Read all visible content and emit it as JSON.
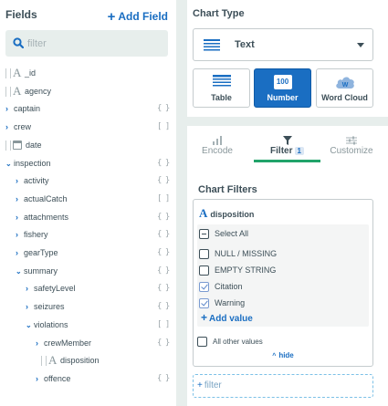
{
  "fields_panel": {
    "title": "Fields",
    "add_field_label": "Add Field",
    "filter_placeholder": "filter",
    "items": [
      {
        "label": "_id",
        "kind": "string",
        "expandable": false,
        "badge": "",
        "depth": 0
      },
      {
        "label": "agency",
        "kind": "string",
        "expandable": false,
        "badge": "",
        "depth": 0
      },
      {
        "label": "captain",
        "kind": "object",
        "expandable": true,
        "expanded": false,
        "badge": "{ }",
        "depth": 0
      },
      {
        "label": "crew",
        "kind": "array",
        "expandable": true,
        "expanded": false,
        "badge": "[ ]",
        "depth": 0
      },
      {
        "label": "date",
        "kind": "date",
        "expandable": false,
        "badge": "",
        "depth": 0
      },
      {
        "label": "inspection",
        "kind": "object",
        "expandable": true,
        "expanded": true,
        "badge": "{ }",
        "depth": 0
      },
      {
        "label": "activity",
        "kind": "object",
        "expandable": true,
        "expanded": false,
        "badge": "{ }",
        "depth": 1
      },
      {
        "label": "actualCatch",
        "kind": "array",
        "expandable": true,
        "expanded": false,
        "badge": "[ ]",
        "depth": 1
      },
      {
        "label": "attachments",
        "kind": "object",
        "expandable": true,
        "expanded": false,
        "badge": "{ }",
        "depth": 1
      },
      {
        "label": "fishery",
        "kind": "object",
        "expandable": true,
        "expanded": false,
        "badge": "{ }",
        "depth": 1
      },
      {
        "label": "gearType",
        "kind": "object",
        "expandable": true,
        "expanded": false,
        "badge": "{ }",
        "depth": 1
      },
      {
        "label": "summary",
        "kind": "object",
        "expandable": true,
        "expanded": true,
        "badge": "{ }",
        "depth": 1
      },
      {
        "label": "safetyLevel",
        "kind": "object",
        "expandable": true,
        "expanded": false,
        "badge": "{ }",
        "depth": 2
      },
      {
        "label": "seizures",
        "kind": "object",
        "expandable": true,
        "expanded": false,
        "badge": "{ }",
        "depth": 2
      },
      {
        "label": "violations",
        "kind": "array",
        "expandable": true,
        "expanded": true,
        "badge": "[ ]",
        "depth": 2
      },
      {
        "label": "crewMember",
        "kind": "object",
        "expandable": true,
        "expanded": false,
        "badge": "{ }",
        "depth": 3
      },
      {
        "label": "disposition",
        "kind": "string",
        "expandable": false,
        "badge": "",
        "depth": 3
      },
      {
        "label": "offence",
        "kind": "object",
        "expandable": true,
        "expanded": false,
        "badge": "{ }",
        "depth": 3
      }
    ]
  },
  "chart_type": {
    "title": "Chart Type",
    "selected": "Text",
    "tiles": [
      {
        "label": "Table",
        "icon": "table-icon",
        "active": false
      },
      {
        "label": "Number",
        "icon": "number-icon",
        "icon_text": "100",
        "active": true
      },
      {
        "label": "Word Cloud",
        "icon": "word-cloud-icon",
        "icon_text": "W",
        "active": false
      }
    ]
  },
  "tabs": [
    {
      "label": "Encode",
      "icon": "encode-icon",
      "active": false
    },
    {
      "label": "Filter",
      "icon": "filter-icon",
      "active": true,
      "count": "1"
    },
    {
      "label": "Customize",
      "icon": "customize-icon",
      "active": false
    }
  ],
  "chart_filters": {
    "title": "Chart Filters",
    "field": "disposition",
    "options": [
      {
        "label": "Select All",
        "state": "partial"
      },
      {
        "label": "NULL / MISSING",
        "state": "unchecked"
      },
      {
        "label": "EMPTY STRING",
        "state": "unchecked"
      },
      {
        "label": "Citation",
        "state": "checked"
      },
      {
        "label": "Warning",
        "state": "checked"
      }
    ],
    "add_value_label": "Add value",
    "other_values_label": "All other values",
    "hide_label": "hide",
    "add_filter_placeholder": "filter"
  },
  "colors": {
    "accent_blue": "#1a6ec2",
    "active_tab_underline": "#21a36a",
    "panel_gutter": "#e7eeec",
    "text_primary": "#3d4f58"
  }
}
